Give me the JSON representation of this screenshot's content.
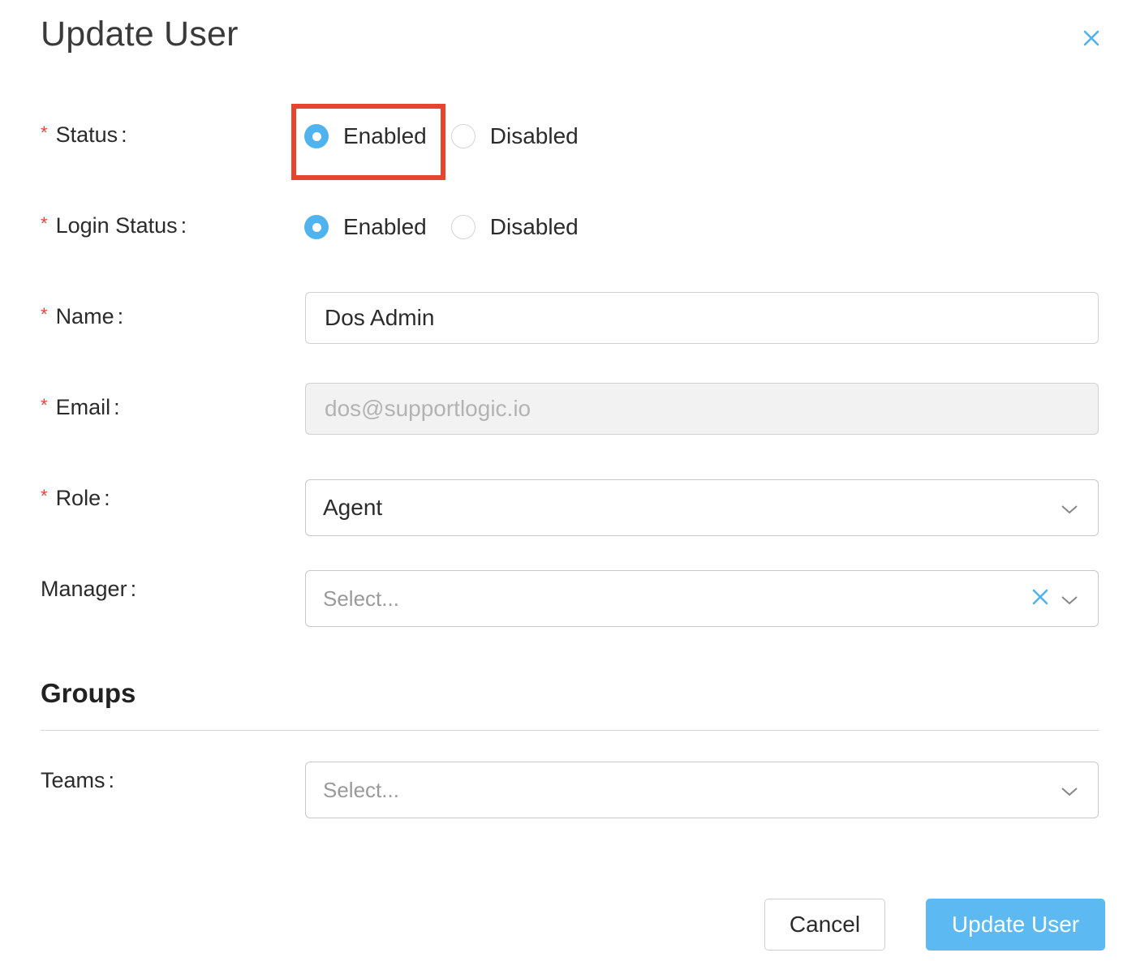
{
  "modal": {
    "title": "Update User",
    "close_icon": "close-icon"
  },
  "form": {
    "status": {
      "label": "Status",
      "required": "*",
      "options": [
        {
          "label": "Enabled",
          "checked": true
        },
        {
          "label": "Disabled",
          "checked": false
        }
      ]
    },
    "login_status": {
      "label": "Login Status",
      "required": "*",
      "options": [
        {
          "label": "Enabled",
          "checked": true
        },
        {
          "label": "Disabled",
          "checked": false
        }
      ]
    },
    "name": {
      "label": "Name",
      "required": "*",
      "value": "Dos Admin"
    },
    "email": {
      "label": "Email",
      "required": "*",
      "value": "dos@supportlogic.io",
      "disabled": true
    },
    "role": {
      "label": "Role",
      "required": "*",
      "value": "Agent"
    },
    "manager": {
      "label": "Manager",
      "placeholder": "Select..."
    }
  },
  "groups": {
    "title": "Groups",
    "teams": {
      "label": "Teams",
      "placeholder": "Select..."
    }
  },
  "footer": {
    "cancel_label": "Cancel",
    "submit_label": "Update User"
  },
  "colors": {
    "accent": "#4fb3f0",
    "primary_button": "#5db9f2",
    "required_marker": "#e8432d",
    "highlight_box": "#e8432d"
  }
}
